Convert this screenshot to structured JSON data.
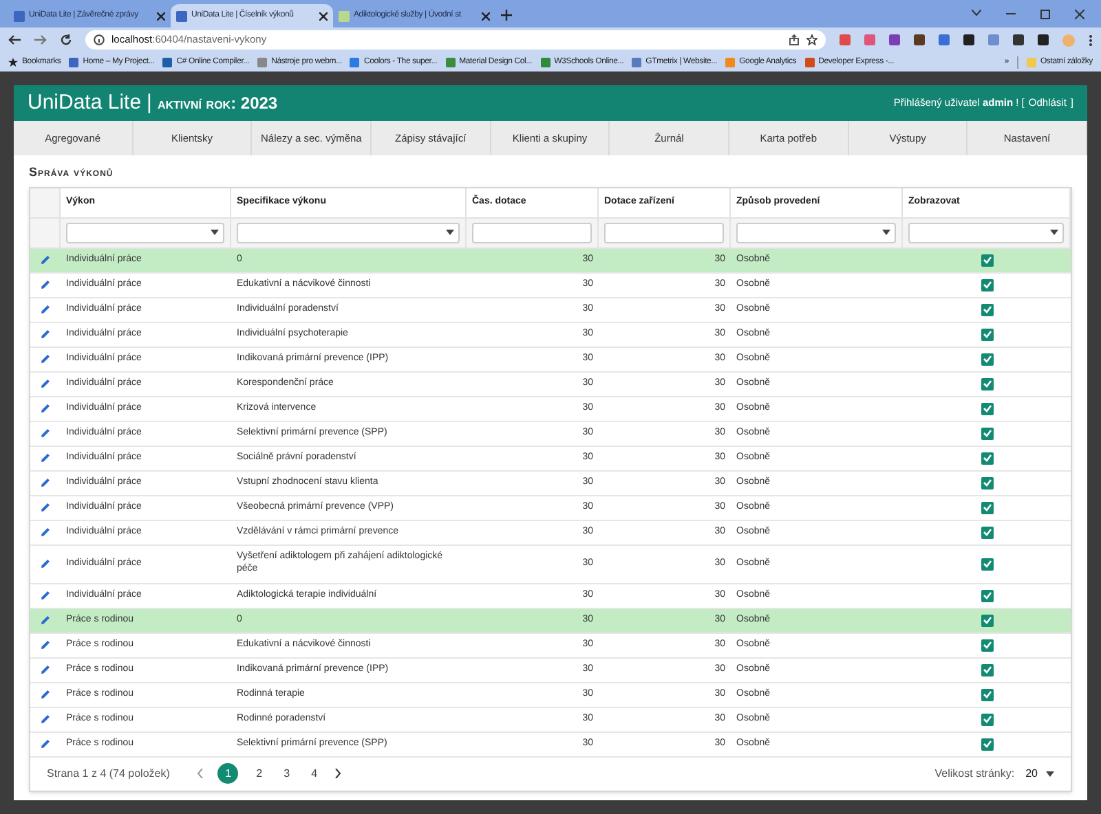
{
  "browser": {
    "tabs": [
      {
        "title": "UniData Lite | Závěrečné zprávy",
        "selected": false
      },
      {
        "title": "UniData Lite | Číselník výkonů",
        "selected": true
      },
      {
        "title": "Adiktologické služby | Úvodní st",
        "selected": false
      }
    ],
    "address": {
      "host": "localhost",
      "rest": ":60404/nastaveni-vykony"
    },
    "bookmarks": [
      "Bookmarks",
      "Home – My Project...",
      "C# Online Compiler...",
      "Nástroje pro webm...",
      "Coolors - The super...",
      "Material Design Col...",
      "W3Schools Online...",
      "GTmetrix | Website...",
      "Google Analytics",
      "Developer Express -..."
    ],
    "more_bookmarks": "»",
    "other_bookmarks": "Ostatní záložky"
  },
  "header": {
    "app": "UniData Lite",
    "separator": "|",
    "year_label": "aktivní rok: 2023",
    "user_prefix": "Přihlášený uživatel",
    "user": "admin",
    "user_suffix": "! [",
    "logout": "Odhlásit",
    "logout_suffix": "]"
  },
  "nav": [
    {
      "label": "Agregované",
      "selected": false
    },
    {
      "label": "Klientsky",
      "selected": false
    },
    {
      "label": "Nálezy a sec. výměna",
      "selected": false
    },
    {
      "label": "Zápisy stávající",
      "selected": false
    },
    {
      "label": "Klienti a skupiny",
      "selected": false
    },
    {
      "label": "Žurnál",
      "selected": false
    },
    {
      "label": "Karta potřeb",
      "selected": false
    },
    {
      "label": "Výstupy",
      "selected": false
    },
    {
      "label": "Nastavení",
      "selected": false
    }
  ],
  "page_title": "Správa výkonů",
  "table": {
    "columns": [
      {
        "label": "Výkon",
        "kind": "select"
      },
      {
        "label": "Specifikace výkonu",
        "kind": "select"
      },
      {
        "label": "Čas. dotace",
        "kind": "text"
      },
      {
        "label": "Dotace zařízení",
        "kind": "text"
      },
      {
        "label": "Způsob provedení",
        "kind": "select"
      },
      {
        "label": "Zobrazovat",
        "kind": "select"
      }
    ],
    "rows": [
      {
        "cells": [
          "Individuální práce",
          "0",
          "30",
          "30",
          "Osobně"
        ],
        "checked": true,
        "highlighted": true
      },
      {
        "cells": [
          "Individuální práce",
          "Edukativní a nácvikové činnosti",
          "30",
          "30",
          "Osobně"
        ],
        "checked": true,
        "highlighted": false
      },
      {
        "cells": [
          "Individuální práce",
          "Individuální poradenství",
          "30",
          "30",
          "Osobně"
        ],
        "checked": true,
        "highlighted": false
      },
      {
        "cells": [
          "Individuální práce",
          "Individuální psychoterapie",
          "30",
          "30",
          "Osobně"
        ],
        "checked": true,
        "highlighted": false
      },
      {
        "cells": [
          "Individuální práce",
          "Indikovaná primární prevence (IPP)",
          "30",
          "30",
          "Osobně"
        ],
        "checked": true,
        "highlighted": false
      },
      {
        "cells": [
          "Individuální práce",
          "Korespondenční práce",
          "30",
          "30",
          "Osobně"
        ],
        "checked": true,
        "highlighted": false
      },
      {
        "cells": [
          "Individuální práce",
          "Krizová intervence",
          "30",
          "30",
          "Osobně"
        ],
        "checked": true,
        "highlighted": false
      },
      {
        "cells": [
          "Individuální práce",
          "Selektivní primární prevence (SPP)",
          "30",
          "30",
          "Osobně"
        ],
        "checked": true,
        "highlighted": false
      },
      {
        "cells": [
          "Individuální práce",
          "Sociálně právní poradenství",
          "30",
          "30",
          "Osobně"
        ],
        "checked": true,
        "highlighted": false
      },
      {
        "cells": [
          "Individuální práce",
          "Vstupní zhodnocení stavu klienta",
          "30",
          "30",
          "Osobně"
        ],
        "checked": true,
        "highlighted": false
      },
      {
        "cells": [
          "Individuální práce",
          "Všeobecná primární prevence (VPP)",
          "30",
          "30",
          "Osobně"
        ],
        "checked": true,
        "highlighted": false
      },
      {
        "cells": [
          "Individuální práce",
          "Vzdělávání v rámci primární prevence",
          "30",
          "30",
          "Osobně"
        ],
        "checked": true,
        "highlighted": false
      },
      {
        "cells": [
          "Individuální práce",
          "Vyšetření adiktologem při zahájení adiktologické péče",
          "30",
          "30",
          "Osobně"
        ],
        "checked": true,
        "highlighted": false
      },
      {
        "cells": [
          "Individuální práce",
          "Adiktologická terapie individuální",
          "30",
          "30",
          "Osobně"
        ],
        "checked": true,
        "highlighted": false
      },
      {
        "cells": [
          "Práce s rodinou",
          "0",
          "30",
          "30",
          "Osobně"
        ],
        "checked": true,
        "highlighted": true
      },
      {
        "cells": [
          "Práce s rodinou",
          "Edukativní a nácvikové činnosti",
          "30",
          "30",
          "Osobně"
        ],
        "checked": true,
        "highlighted": false
      },
      {
        "cells": [
          "Práce s rodinou",
          "Indikovaná primární prevence (IPP)",
          "30",
          "30",
          "Osobně"
        ],
        "checked": true,
        "highlighted": false
      },
      {
        "cells": [
          "Práce s rodinou",
          "Rodinná terapie",
          "30",
          "30",
          "Osobně"
        ],
        "checked": true,
        "highlighted": false
      },
      {
        "cells": [
          "Práce s rodinou",
          "Rodinné poradenství",
          "30",
          "30",
          "Osobně"
        ],
        "checked": true,
        "highlighted": false
      },
      {
        "cells": [
          "Práce s rodinou",
          "Selektivní primární prevence (SPP)",
          "30",
          "30",
          "Osobně"
        ],
        "checked": true,
        "highlighted": false
      }
    ]
  },
  "pager": {
    "info": "Strana 1 z 4 (74 položek)",
    "pages": [
      {
        "label": "1",
        "selected": true
      },
      {
        "label": "2",
        "selected": false
      },
      {
        "label": "3",
        "selected": false
      },
      {
        "label": "4",
        "selected": false
      }
    ],
    "size_label": "Velikost stránky:",
    "size": "20"
  }
}
